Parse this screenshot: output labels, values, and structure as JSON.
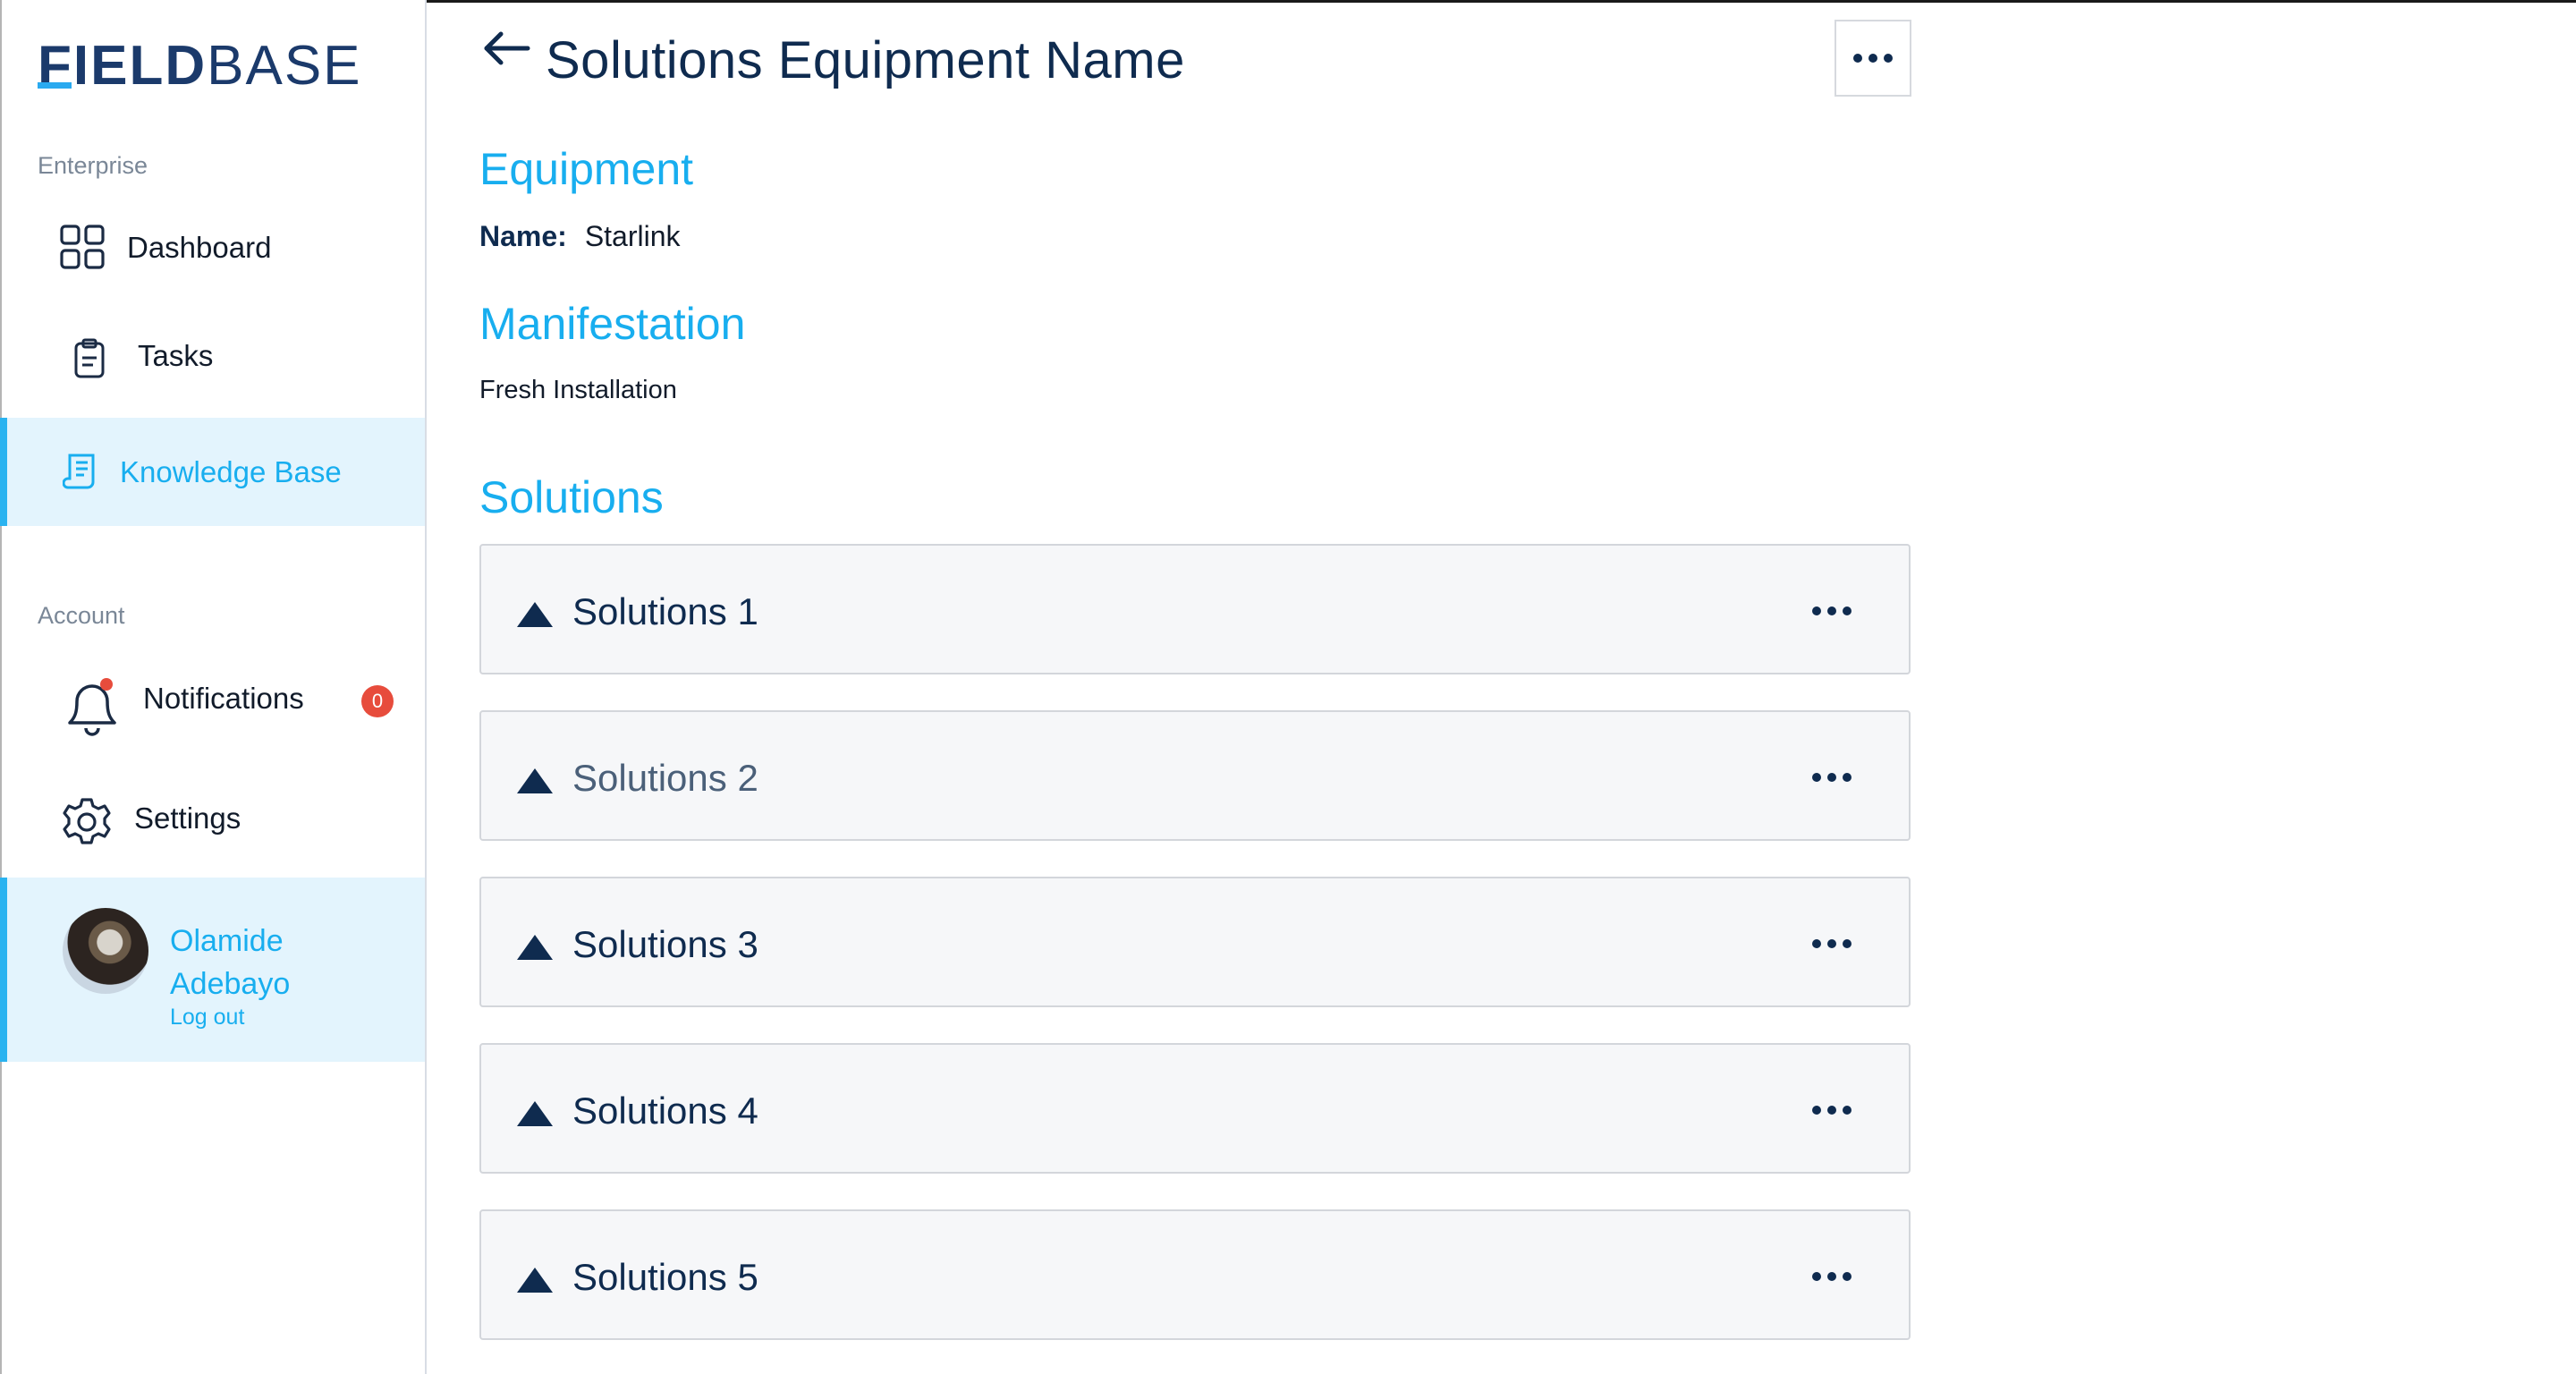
{
  "app": {
    "logo_bold": "FIELD",
    "logo_thin": "BASE"
  },
  "sidebar": {
    "section_enterprise": "Enterprise",
    "section_account": "Account",
    "items": [
      {
        "label": "Dashboard",
        "icon": "grid-icon"
      },
      {
        "label": "Tasks",
        "icon": "clipboard-icon"
      },
      {
        "label": "Knowledge Base",
        "icon": "document-icon",
        "active": true
      },
      {
        "label": "Notifications",
        "icon": "bell-icon",
        "badge": "0"
      },
      {
        "label": "Settings",
        "icon": "gear-icon"
      }
    ],
    "profile": {
      "first_name": "Olamide",
      "last_name": "Adebayo",
      "logout": "Log out"
    }
  },
  "header": {
    "title": "Solutions Equipment Name"
  },
  "equipment": {
    "heading": "Equipment",
    "name_label": "Name:",
    "name_value": "Starlink"
  },
  "manifestation": {
    "heading": "Manifestation",
    "value": "Fresh Installation"
  },
  "solutions": {
    "heading": "Solutions",
    "items": [
      {
        "label": "Solutions 1"
      },
      {
        "label": "Solutions 2"
      },
      {
        "label": "Solutions 3"
      },
      {
        "label": "Solutions 4"
      },
      {
        "label": "Solutions 5"
      }
    ]
  },
  "colors": {
    "accent": "#18aeef",
    "navy": "#0f2b4f",
    "active_bg": "#e3f4fd",
    "badge": "#e74c3c"
  }
}
